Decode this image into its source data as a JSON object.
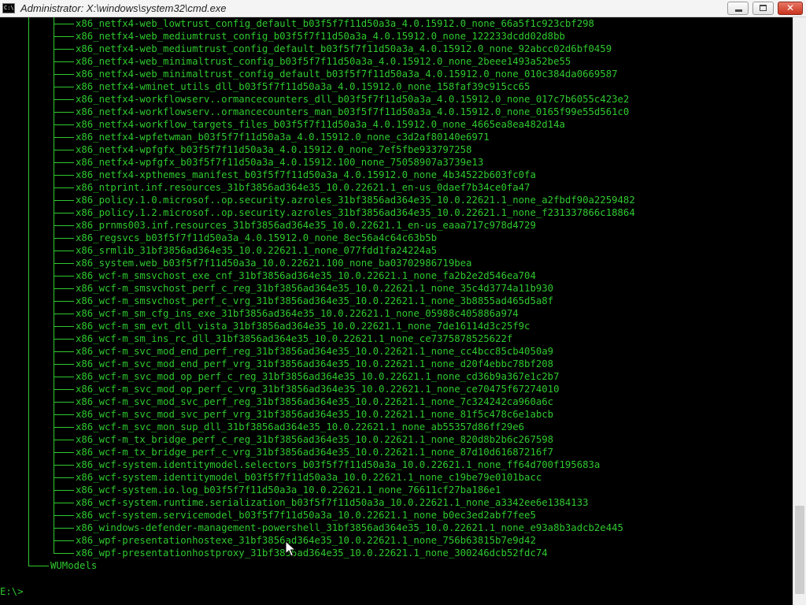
{
  "window": {
    "title": "Administrator: X:\\windows\\system32\\cmd.exe",
    "icon_label": "C:\\"
  },
  "buttons": {
    "minimize": "minimize",
    "maximize": "maximize",
    "close": "✕"
  },
  "tree_entries": [
    "x86_netfx4-web_lowtrust_config_default_b03f5f7f11d50a3a_4.0.15912.0_none_66a5f1c923cbf298",
    "x86_netfx4-web_mediumtrust_config_b03f5f7f11d50a3a_4.0.15912.0_none_122233dcdd02d8bb",
    "x86_netfx4-web_mediumtrust_config_default_b03f5f7f11d50a3a_4.0.15912.0_none_92abcc02d6bf0459",
    "x86_netfx4-web_minimaltrust_config_b03f5f7f11d50a3a_4.0.15912.0_none_2beee1493a52be55",
    "x86_netfx4-web_minimaltrust_config_default_b03f5f7f11d50a3a_4.0.15912.0_none_010c384da0669587",
    "x86_netfx4-wminet_utils_dll_b03f5f7f11d50a3a_4.0.15912.0_none_158faf39c915cc65",
    "x86_netfx4-workflowserv..ormancecounters_dll_b03f5f7f11d50a3a_4.0.15912.0_none_017c7b6055c423e2",
    "x86_netfx4-workflowserv..ormancecounters_man_b03f5f7f11d50a3a_4.0.15912.0_none_0165f99e55d561c0",
    "x86_netfx4-workflow_targets_files_b03f5f7f11d50a3a_4.0.15912.0_none_4665ea8ea482d14a",
    "x86_netfx4-wpfetwman_b03f5f7f11d50a3a_4.0.15912.0_none_c3d2af80140e6971",
    "x86_netfx4-wpfgfx_b03f5f7f11d50a3a_4.0.15912.0_none_7ef5fbe933797258",
    "x86_netfx4-wpfgfx_b03f5f7f11d50a3a_4.0.15912.100_none_75058907a3739e13",
    "x86_netfx4-xpthemes_manifest_b03f5f7f11d50a3a_4.0.15912.0_none_4b34522b603fc0fa",
    "x86_ntprint.inf.resources_31bf3856ad364e35_10.0.22621.1_en-us_0daef7b34ce0fa47",
    "x86_policy.1.0.microsof..op.security.azroles_31bf3856ad364e35_10.0.22621.1_none_a2fbdf90a2259482",
    "x86_policy.1.2.microsof..op.security.azroles_31bf3856ad364e35_10.0.22621.1_none_f231337866c18864",
    "x86_prnms003.inf.resources_31bf3856ad364e35_10.0.22621.1_en-us_eaaa717c978d4729",
    "x86_regsvcs_b03f5f7f11d50a3a_4.0.15912.0_none_8ec56a4c64c63b5b",
    "x86_srmlib_31bf3856ad364e35_10.0.22621.1_none_077fdd1fa24224a5",
    "x86_system.web_b03f5f7f11d50a3a_10.0.22621.100_none_ba03702986719bea",
    "x86_wcf-m_smsvchost_exe_cnf_31bf3856ad364e35_10.0.22621.1_none_fa2b2e2d546ea704",
    "x86_wcf-m_smsvchost_perf_c_reg_31bf3856ad364e35_10.0.22621.1_none_35c4d3774a11b930",
    "x86_wcf-m_smsvchost_perf_c_vrg_31bf3856ad364e35_10.0.22621.1_none_3b8855ad465d5a8f",
    "x86_wcf-m_sm_cfg_ins_exe_31bf3856ad364e35_10.0.22621.1_none_05988c405886a974",
    "x86_wcf-m_sm_evt_dll_vista_31bf3856ad364e35_10.0.22621.1_none_7de16114d3c25f9c",
    "x86_wcf-m_sm_ins_rc_dll_31bf3856ad364e35_10.0.22621.1_none_ce7375878525622f",
    "x86_wcf-m_svc_mod_end_perf_reg_31bf3856ad364e35_10.0.22621.1_none_cc4bcc85cb4050a9",
    "x86_wcf-m_svc_mod_end_perf_vrg_31bf3856ad364e35_10.0.22621.1_none_d20f4ebbc78bf208",
    "x86_wcf-m_svc_mod_op_perf_c_reg_31bf3856ad364e35_10.0.22621.1_none_cd36b9a367e1c2b7",
    "x86_wcf-m_svc_mod_op_perf_c_vrg_31bf3856ad364e35_10.0.22621.1_none_ce70475f67274010",
    "x86_wcf-m_svc_mod_svc_perf_reg_31bf3856ad364e35_10.0.22621.1_none_7c324242ca960a6c",
    "x86_wcf-m_svc_mod_svc_perf_vrg_31bf3856ad364e35_10.0.22621.1_none_81f5c478c6e1abcb",
    "x86_wcf-m_svc_mon_sup_dll_31bf3856ad364e35_10.0.22621.1_none_ab55357d86ff29e6",
    "x86_wcf-m_tx_bridge_perf_c_reg_31bf3856ad364e35_10.0.22621.1_none_820d8b2b6c267598",
    "x86_wcf-m_tx_bridge_perf_c_vrg_31bf3856ad364e35_10.0.22621.1_none_87d10d61687216f7",
    "x86_wcf-system.identitymodel.selectors_b03f5f7f11d50a3a_10.0.22621.1_none_ff64d700f195683a",
    "x86_wcf-system.identitymodel_b03f5f7f11d50a3a_10.0.22621.1_none_c19be79e0101bacc",
    "x86_wcf-system.io.log_b03f5f7f11d50a3a_10.0.22621.1_none_76611cf27ba186e1",
    "x86_wcf-system.runtime.serialization_b03f5f7f11d50a3a_10.0.22621.1_none_a3342ee6e1384133",
    "x86_wcf-system.servicemodel_b03f5f7f11d50a3a_10.0.22621.1_none_b0ec3ed2abf7fee5",
    "x86_windows-defender-management-powershell_31bf3856ad364e35_10.0.22621.1_none_e93a8b3adcb2e445",
    "x86_wpf-presentationhostexe_31bf3856ad364e35_10.0.22621.1_none_756b63815b7e9d42",
    "x86_wpf-presentationhostproxy_31bf3856ad364e35_10.0.22621.1_none_300246dcb52fdc74"
  ],
  "sibling_folder": "WUModels",
  "prompt": "E:\\>",
  "colors": {
    "console_text": "#2fc92f",
    "console_background": "#000000"
  },
  "icons": {
    "window_icon": "cmd-icon",
    "pointer": "mouse-pointer-icon"
  }
}
